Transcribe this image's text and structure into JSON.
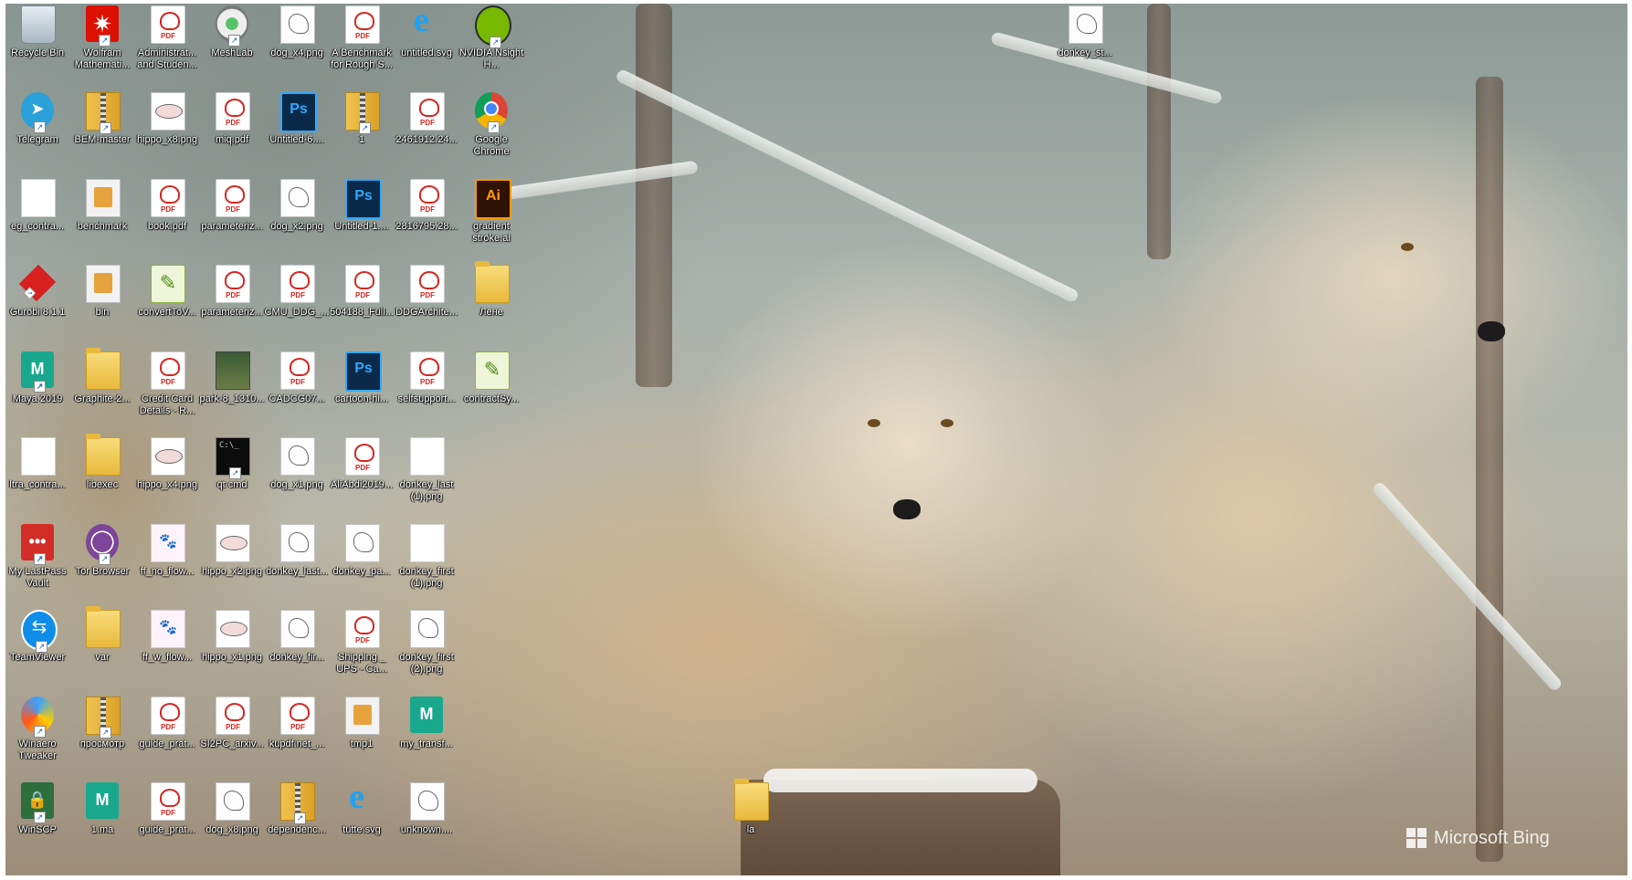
{
  "desktop": {
    "icons": [
      {
        "label": "Recycle Bin",
        "icon": "recycle-bin-icon",
        "kind": "recycle"
      },
      {
        "label": "Wolfram Mathemati...",
        "icon": "wolfram-icon",
        "kind": "wolfram"
      },
      {
        "label": "Administrat... and Studen...",
        "icon": "pdf-icon",
        "kind": "pdf"
      },
      {
        "label": "MeshLab",
        "icon": "meshlab-icon",
        "kind": "meshlab"
      },
      {
        "label": "dog_x4.png",
        "icon": "image-icon",
        "kind": "img"
      },
      {
        "label": "A Benchmark for Rough S...",
        "icon": "pdf-icon",
        "kind": "pdf"
      },
      {
        "label": "untitled.svg",
        "icon": "internet-explorer-icon",
        "kind": "ie"
      },
      {
        "label": "NVIDIA Nsight H...",
        "icon": "nvidia-icon",
        "kind": "nvidia"
      },
      {
        "label": "donkey_st...",
        "icon": "image-icon",
        "kind": "img"
      },
      {
        "label": "Telegram",
        "icon": "telegram-icon",
        "kind": "round-blue"
      },
      {
        "label": "BEM-master",
        "icon": "zip-folder-icon",
        "kind": "zip"
      },
      {
        "label": "hippo_x8.png",
        "icon": "image-icon",
        "kind": "hippo"
      },
      {
        "label": "miq.pdf",
        "icon": "pdf-icon",
        "kind": "pdf"
      },
      {
        "label": "Untitled-6....",
        "icon": "photoshop-icon",
        "kind": "ps"
      },
      {
        "label": "1",
        "icon": "zip-folder-icon",
        "kind": "zip"
      },
      {
        "label": "2461912.24...",
        "icon": "pdf-icon",
        "kind": "pdf"
      },
      {
        "label": "Google Chrome",
        "icon": "chrome-icon",
        "kind": "chrome"
      },
      {
        "label": "eg_contra...",
        "icon": "file-icon",
        "kind": "small-white"
      },
      {
        "label": "benchmark",
        "icon": "chrome-folder-icon",
        "kind": "doc-orange"
      },
      {
        "label": "book.pdf",
        "icon": "pdf-icon",
        "kind": "pdf"
      },
      {
        "label": "parameteriz...",
        "icon": "pdf-icon",
        "kind": "pdf"
      },
      {
        "label": "dog_x2.png",
        "icon": "image-icon",
        "kind": "img"
      },
      {
        "label": "Untitled-1....",
        "icon": "photoshop-icon",
        "kind": "ps"
      },
      {
        "label": "2816795.28...",
        "icon": "pdf-icon",
        "kind": "pdf"
      },
      {
        "label": "gradient stroke.ai",
        "icon": "illustrator-icon",
        "kind": "ai"
      },
      {
        "label": "Gurobi 8.1.1",
        "icon": "gurobi-icon",
        "kind": "gurobi"
      },
      {
        "label": "bin",
        "icon": "folder-icon",
        "kind": "doc-orange"
      },
      {
        "label": "convertToV...",
        "icon": "app-icon",
        "kind": "green-app"
      },
      {
        "label": "parameteriz...",
        "icon": "pdf-icon",
        "kind": "pdf"
      },
      {
        "label": "CMU_DDG_...",
        "icon": "pdf-icon",
        "kind": "pdf"
      },
      {
        "label": "504188_Full...",
        "icon": "pdf-icon",
        "kind": "pdf"
      },
      {
        "label": "DDGArchite...",
        "icon": "pdf-icon",
        "kind": "pdf"
      },
      {
        "label": "Лене",
        "icon": "folder-icon",
        "kind": "folder"
      },
      {
        "label": "Maya 2019",
        "icon": "maya-icon",
        "kind": "maya"
      },
      {
        "label": "Graphite-2...",
        "icon": "folder-icon",
        "kind": "folder"
      },
      {
        "label": "Credit Card Details - R...",
        "icon": "pdf-icon",
        "kind": "pdf"
      },
      {
        "label": "park-8_1310...",
        "icon": "photo-icon",
        "kind": "photo"
      },
      {
        "label": "CADCG07...",
        "icon": "pdf-icon",
        "kind": "pdf"
      },
      {
        "label": "cartoon-hi...",
        "icon": "photoshop-icon",
        "kind": "ps"
      },
      {
        "label": "selfsupport...",
        "icon": "pdf-icon",
        "kind": "pdf"
      },
      {
        "label": "contractSy...",
        "icon": "app-icon",
        "kind": "green-app"
      },
      {
        "label": "ltra_contra...",
        "icon": "file-icon",
        "kind": "small-white"
      },
      {
        "label": "libexec",
        "icon": "folder-icon",
        "kind": "folder"
      },
      {
        "label": "hippo_x4.png",
        "icon": "image-icon",
        "kind": "hippo"
      },
      {
        "label": "qt cmd",
        "icon": "cmd-icon",
        "kind": "cmd"
      },
      {
        "label": "dog_x1.png",
        "icon": "image-icon",
        "kind": "img"
      },
      {
        "label": "AliAbdi2019...",
        "icon": "pdf-icon",
        "kind": "pdf"
      },
      {
        "label": "donkey_last (1).png",
        "icon": "blank-file-icon",
        "kind": "blank"
      },
      {
        "label": "My LastPass Vault",
        "icon": "lastpass-icon",
        "kind": "lastpass"
      },
      {
        "label": "Tor Browser",
        "icon": "tor-icon",
        "kind": "tor"
      },
      {
        "label": "ff_no_flow...",
        "icon": "image-icon",
        "kind": "pink"
      },
      {
        "label": "hippo_x2.png",
        "icon": "image-icon",
        "kind": "hippo"
      },
      {
        "label": "donkey_last...",
        "icon": "image-icon",
        "kind": "img"
      },
      {
        "label": "donkey_pa...",
        "icon": "image-icon",
        "kind": "img"
      },
      {
        "label": "donkey_first (1).png",
        "icon": "blank-file-icon",
        "kind": "blank"
      },
      {
        "label": "TeamViewer",
        "icon": "teamviewer-icon",
        "kind": "teamviewer"
      },
      {
        "label": "var",
        "icon": "folder-icon",
        "kind": "folder"
      },
      {
        "label": "ff_w_flow...",
        "icon": "image-icon",
        "kind": "pink"
      },
      {
        "label": "hippo_x1.png",
        "icon": "image-icon",
        "kind": "hippo"
      },
      {
        "label": "donkey_fir...",
        "icon": "image-icon",
        "kind": "img"
      },
      {
        "label": "Shipping _ UPS - Ca...",
        "icon": "pdf-icon",
        "kind": "pdf"
      },
      {
        "label": "donkey_first (2).png",
        "icon": "image-icon",
        "kind": "img"
      },
      {
        "label": "Winaero Tweaker",
        "icon": "winaero-icon",
        "kind": "winaero"
      },
      {
        "label": "просмотр",
        "icon": "zip-folder-icon",
        "kind": "zip"
      },
      {
        "label": "guide_prat...",
        "icon": "pdf-icon",
        "kind": "pdf"
      },
      {
        "label": "SI2PC_arxiv...",
        "icon": "pdf-icon",
        "kind": "pdf"
      },
      {
        "label": "kupdf.net_...",
        "icon": "pdf-icon",
        "kind": "pdf"
      },
      {
        "label": "tmp1",
        "icon": "chrome-folder-icon",
        "kind": "doc-orange"
      },
      {
        "label": "my_transf...",
        "icon": "maya-icon",
        "kind": "maya"
      },
      {
        "label": "WinSCP",
        "icon": "winscp-icon",
        "kind": "winscp"
      },
      {
        "label": "1.ma",
        "icon": "maya-icon",
        "kind": "maya"
      },
      {
        "label": "guide_prat...",
        "icon": "pdf-icon",
        "kind": "pdf"
      },
      {
        "label": "dog_x8.png",
        "icon": "image-icon",
        "kind": "img"
      },
      {
        "label": "dependenc...",
        "icon": "zip-folder-icon",
        "kind": "zip"
      },
      {
        "label": "tutte.svg",
        "icon": "internet-explorer-icon",
        "kind": "ie"
      },
      {
        "label": "unknown....",
        "icon": "image-icon",
        "kind": "img"
      },
      {
        "label": "la",
        "icon": "folder-icon",
        "kind": "folder"
      }
    ]
  },
  "watermark": {
    "text": "Microsoft Bing"
  }
}
